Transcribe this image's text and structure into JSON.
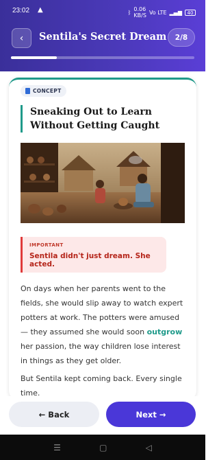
{
  "status_bar": {
    "time": "23:02",
    "data_speed": "0.06",
    "data_unit": "KB/S",
    "network": "Vo LTE",
    "battery": "40"
  },
  "header": {
    "title": "Sentila's Secret Dream",
    "page_indicator": "2/8",
    "progress_fraction": 0.25
  },
  "card": {
    "tag": "CONCEPT",
    "title": "Sneaking Out to Learn Without Getting Caught",
    "callout": {
      "label": "IMPORTANT",
      "text": "Sentila didn't just dream. She acted."
    },
    "para1_before": "On days when her parents went to the fields, she would slip away to watch expert potters at work. The potters were amused — they assumed she would soon ",
    "para1_highlight": "outgrow",
    "para1_after": " her passion, the way children lose interest in things as they get older.",
    "para2": "But Sentila kept coming back. Every single time."
  },
  "nav": {
    "back_label": "← Back",
    "next_label": "Next →"
  },
  "colors": {
    "accent": "#4a37d8",
    "teal": "#1f9a8a",
    "alert": "#e03a3a"
  }
}
